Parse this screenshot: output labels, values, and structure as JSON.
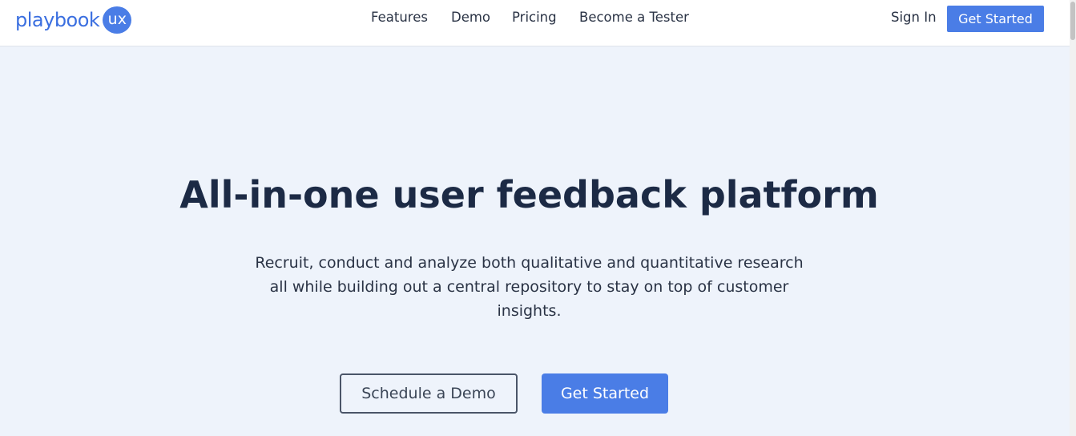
{
  "header": {
    "logo_text": "playbook",
    "logo_badge": "ux",
    "nav": {
      "features": "Features",
      "demo": "Demo",
      "pricing": "Pricing",
      "tester": "Become a Tester"
    },
    "sign_in": "Sign In",
    "cta": "Get Started"
  },
  "hero": {
    "title": "All-in-one user feedback platform",
    "subtitle": "Recruit, conduct and analyze both qualitative and quantitative research all while building out a central repository to stay on top of customer insights.",
    "demo_button": "Schedule a Demo",
    "start_button": "Get Started"
  },
  "colors": {
    "brand": "#4a7de6",
    "background": "#eef3fb",
    "heading": "#1c2a45"
  }
}
